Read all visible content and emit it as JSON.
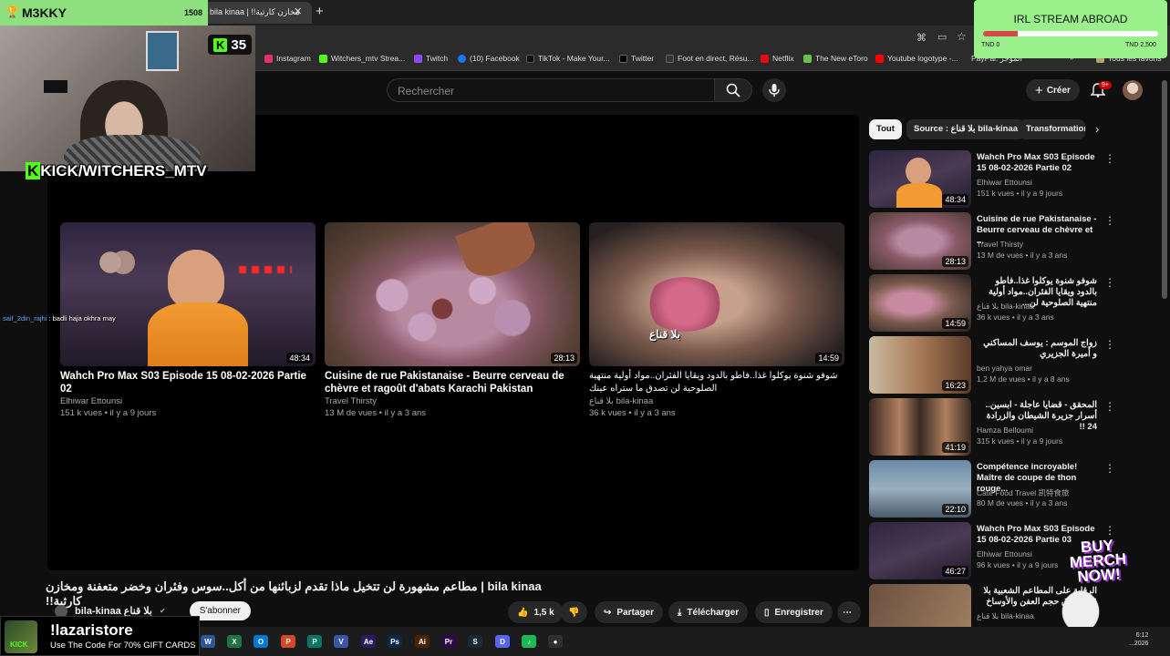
{
  "browser": {
    "tab_title": "bila kinaa | !!مخازن كارثية",
    "bookmarks": [
      {
        "label": "Instagram",
        "color": "#e1306c"
      },
      {
        "label": "Witchers_mtv Strea...",
        "color": "#53fc18"
      },
      {
        "label": "Twitch",
        "color": "#9146ff"
      },
      {
        "label": "(10) Facebook",
        "color": "#1877f2"
      },
      {
        "label": "TikTok - Make Your...",
        "color": "#111111"
      },
      {
        "label": "Twitter",
        "color": "#000000"
      },
      {
        "label": "Foot en direct, Résu...",
        "color": "#333333"
      },
      {
        "label": "Netflix",
        "color": "#e50914"
      },
      {
        "label": "The New eToro",
        "color": "#6cc04a"
      },
      {
        "label": "Youtube logotype -...",
        "color": "#ff0000"
      },
      {
        "label": "PayPal: الموجز",
        "color": "#003087"
      }
    ],
    "all_favorites": "Tous les favoris"
  },
  "header": {
    "search_placeholder": "Rechercher",
    "create_label": "Créer",
    "notification_count": "9+"
  },
  "endscreen": [
    {
      "title": "Wahch Pro Max S03 Episode 15 08-02-2026 Partie 02",
      "channel": "Elhiwar Ettounsi",
      "meta": "151 k vues • il y a 9 jours",
      "duration": "48:34"
    },
    {
      "title": "Cuisine de rue Pakistanaise - Beurre cerveau de chèvre et ragoût d'abats Karachi Pakistan",
      "channel": "Travel Thirsty",
      "meta": "13 M de vues • il y a 3 ans",
      "duration": "28:13"
    },
    {
      "title": "شوفو شنوة يوكلوا غذا..فاطو بالدود ويقايا الفئران..مواد أولية منتهية الصلوحية لن تصدق ما ستراه عينك",
      "channel": "بلا قناع bila-kinaa",
      "meta": "36 k vues • il y a 3 ans",
      "duration": "14:59"
    }
  ],
  "video": {
    "title": "bila kinaa | مطاعم مشهورة لن تتخيل ماذا تقدم لزبائنها من أكل..سوس وفئران وخضر متعفنة ومخازن كارثية!!",
    "channel": "bila-kinaa بلا قناع",
    "subscribe": "S'abonner",
    "likes": "1,5 k",
    "share": "Partager",
    "download": "Télécharger",
    "save": "Enregistrer"
  },
  "chips": [
    "Tout",
    "Source : بلا قناع bila-kinaa",
    "Transformation"
  ],
  "sidebar": [
    {
      "title": "Wahch Pro Max S03 Episode 15 08-02-2026 Partie 02",
      "channel": "Elhiwar Ettounsi",
      "meta": "151 k vues • il y a 9 jours",
      "duration": "48:34",
      "rtl": false
    },
    {
      "title": "Cuisine de rue Pakistanaise - Beurre cerveau de chèvre et ...",
      "channel": "Travel Thirsty",
      "meta": "13 M de vues • il y a 3 ans",
      "duration": "28:13",
      "rtl": false
    },
    {
      "title": "شوفو شنوة يوكلوا غذا..فاطو بالدود ويقايا الفئران..مواد أولية منتهية الصلوحية لن...",
      "channel": "بلا قناع bila-kinaa",
      "meta": "36 k vues • il y a 3 ans",
      "duration": "14:59",
      "rtl": true
    },
    {
      "title": "زواج الموسم : يوسف المساكني و أميرة الجزيري",
      "channel": "ben yahya omar",
      "meta": "1,2 M de vues • il y a 8 ans",
      "duration": "16:23",
      "rtl": true
    },
    {
      "title": "المحقق - قضايا عاجلة - ابسين.. أسرار جزيرة الشيطان والزرادة 24 !!",
      "channel": "Hamza Belloumi",
      "meta": "315 k vues • il y a 9 jours",
      "duration": "41:19",
      "rtl": true
    },
    {
      "title": "Compétence incroyable! Maître de coupe de thon rouge...",
      "channel": "Cate Food Travel 凯特食旅",
      "meta": "80 M de vues • il y a 3 ans",
      "duration": "22:10",
      "rtl": false
    },
    {
      "title": "Wahch Pro Max S03 Episode 15 08-02-2026 Partie 03",
      "channel": "Elhiwar Ettounsi",
      "meta": "96 k vues • il y a 9 jours",
      "duration": "46:27",
      "rtl": false
    },
    {
      "title": "الرقابة على المطاعم الشعبية بلا قناع صدق حجم العفن والأوساخ",
      "channel": "بلا قناع bila-kinaa",
      "meta": "",
      "duration": "",
      "rtl": true
    }
  ],
  "overlay": {
    "streamer_name": "M3KKY",
    "streamer_points": "1508",
    "kick_viewers": "35",
    "kick_handle": "KICK/WITCHERS_MTV",
    "goal_title": "IRL STREAM ABROAD",
    "goal_progress_label": "TND 0",
    "goal_target_label": "TND 2,500",
    "goal_progress": 0.2,
    "chat_user": "saif_2din_rajhi",
    "chat_text": ": badli haja okhra may",
    "store_name": "!lazaristore",
    "store_promo": "Use The Code For 70% GIFT CARDS",
    "merch": "BUY MERCH NOW!"
  },
  "taskbar_apps": [
    {
      "name": "word",
      "label": "W",
      "color": "#2b579a"
    },
    {
      "name": "excel",
      "label": "X",
      "color": "#217346"
    },
    {
      "name": "outlook",
      "label": "O",
      "color": "#0078d4"
    },
    {
      "name": "powerpoint",
      "label": "P",
      "color": "#d24726"
    },
    {
      "name": "publisher",
      "label": "P",
      "color": "#077568"
    },
    {
      "name": "visio",
      "label": "V",
      "color": "#3955a3"
    },
    {
      "name": "after-effects",
      "label": "Ae",
      "color": "#2c1a64"
    },
    {
      "name": "photoshop",
      "label": "Ps",
      "color": "#0a2a4a"
    },
    {
      "name": "illustrator",
      "label": "Ai",
      "color": "#4a2400"
    },
    {
      "name": "premiere",
      "label": "Pr",
      "color": "#2a0a4a"
    },
    {
      "name": "steam",
      "label": "S",
      "color": "#1b2838"
    },
    {
      "name": "discord",
      "label": "D",
      "color": "#5865f2"
    },
    {
      "name": "spotify",
      "label": "♪",
      "color": "#1db954"
    },
    {
      "name": "obs",
      "label": "●",
      "color": "#302e31"
    }
  ],
  "clock": {
    "time": "6:12",
    "date": "...2026"
  }
}
